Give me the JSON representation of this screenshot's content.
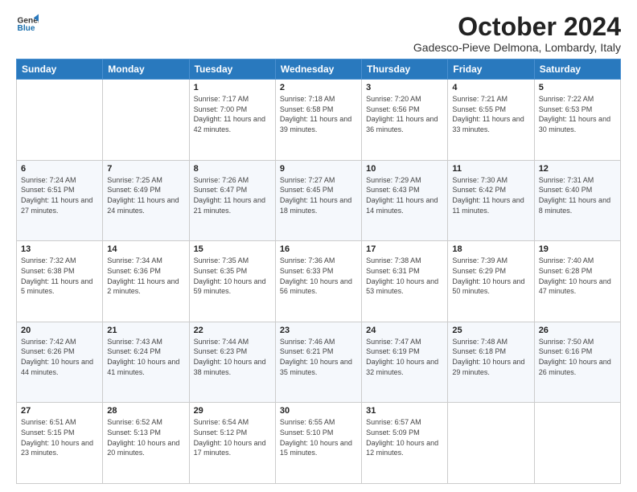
{
  "header": {
    "logo_line1": "General",
    "logo_line2": "Blue",
    "month": "October 2024",
    "location": "Gadesco-Pieve Delmona, Lombardy, Italy"
  },
  "days_of_week": [
    "Sunday",
    "Monday",
    "Tuesday",
    "Wednesday",
    "Thursday",
    "Friday",
    "Saturday"
  ],
  "weeks": [
    [
      {
        "day": "",
        "info": ""
      },
      {
        "day": "",
        "info": ""
      },
      {
        "day": "1",
        "info": "Sunrise: 7:17 AM\nSunset: 7:00 PM\nDaylight: 11 hours and 42 minutes."
      },
      {
        "day": "2",
        "info": "Sunrise: 7:18 AM\nSunset: 6:58 PM\nDaylight: 11 hours and 39 minutes."
      },
      {
        "day": "3",
        "info": "Sunrise: 7:20 AM\nSunset: 6:56 PM\nDaylight: 11 hours and 36 minutes."
      },
      {
        "day": "4",
        "info": "Sunrise: 7:21 AM\nSunset: 6:55 PM\nDaylight: 11 hours and 33 minutes."
      },
      {
        "day": "5",
        "info": "Sunrise: 7:22 AM\nSunset: 6:53 PM\nDaylight: 11 hours and 30 minutes."
      }
    ],
    [
      {
        "day": "6",
        "info": "Sunrise: 7:24 AM\nSunset: 6:51 PM\nDaylight: 11 hours and 27 minutes."
      },
      {
        "day": "7",
        "info": "Sunrise: 7:25 AM\nSunset: 6:49 PM\nDaylight: 11 hours and 24 minutes."
      },
      {
        "day": "8",
        "info": "Sunrise: 7:26 AM\nSunset: 6:47 PM\nDaylight: 11 hours and 21 minutes."
      },
      {
        "day": "9",
        "info": "Sunrise: 7:27 AM\nSunset: 6:45 PM\nDaylight: 11 hours and 18 minutes."
      },
      {
        "day": "10",
        "info": "Sunrise: 7:29 AM\nSunset: 6:43 PM\nDaylight: 11 hours and 14 minutes."
      },
      {
        "day": "11",
        "info": "Sunrise: 7:30 AM\nSunset: 6:42 PM\nDaylight: 11 hours and 11 minutes."
      },
      {
        "day": "12",
        "info": "Sunrise: 7:31 AM\nSunset: 6:40 PM\nDaylight: 11 hours and 8 minutes."
      }
    ],
    [
      {
        "day": "13",
        "info": "Sunrise: 7:32 AM\nSunset: 6:38 PM\nDaylight: 11 hours and 5 minutes."
      },
      {
        "day": "14",
        "info": "Sunrise: 7:34 AM\nSunset: 6:36 PM\nDaylight: 11 hours and 2 minutes."
      },
      {
        "day": "15",
        "info": "Sunrise: 7:35 AM\nSunset: 6:35 PM\nDaylight: 10 hours and 59 minutes."
      },
      {
        "day": "16",
        "info": "Sunrise: 7:36 AM\nSunset: 6:33 PM\nDaylight: 10 hours and 56 minutes."
      },
      {
        "day": "17",
        "info": "Sunrise: 7:38 AM\nSunset: 6:31 PM\nDaylight: 10 hours and 53 minutes."
      },
      {
        "day": "18",
        "info": "Sunrise: 7:39 AM\nSunset: 6:29 PM\nDaylight: 10 hours and 50 minutes."
      },
      {
        "day": "19",
        "info": "Sunrise: 7:40 AM\nSunset: 6:28 PM\nDaylight: 10 hours and 47 minutes."
      }
    ],
    [
      {
        "day": "20",
        "info": "Sunrise: 7:42 AM\nSunset: 6:26 PM\nDaylight: 10 hours and 44 minutes."
      },
      {
        "day": "21",
        "info": "Sunrise: 7:43 AM\nSunset: 6:24 PM\nDaylight: 10 hours and 41 minutes."
      },
      {
        "day": "22",
        "info": "Sunrise: 7:44 AM\nSunset: 6:23 PM\nDaylight: 10 hours and 38 minutes."
      },
      {
        "day": "23",
        "info": "Sunrise: 7:46 AM\nSunset: 6:21 PM\nDaylight: 10 hours and 35 minutes."
      },
      {
        "day": "24",
        "info": "Sunrise: 7:47 AM\nSunset: 6:19 PM\nDaylight: 10 hours and 32 minutes."
      },
      {
        "day": "25",
        "info": "Sunrise: 7:48 AM\nSunset: 6:18 PM\nDaylight: 10 hours and 29 minutes."
      },
      {
        "day": "26",
        "info": "Sunrise: 7:50 AM\nSunset: 6:16 PM\nDaylight: 10 hours and 26 minutes."
      }
    ],
    [
      {
        "day": "27",
        "info": "Sunrise: 6:51 AM\nSunset: 5:15 PM\nDaylight: 10 hours and 23 minutes."
      },
      {
        "day": "28",
        "info": "Sunrise: 6:52 AM\nSunset: 5:13 PM\nDaylight: 10 hours and 20 minutes."
      },
      {
        "day": "29",
        "info": "Sunrise: 6:54 AM\nSunset: 5:12 PM\nDaylight: 10 hours and 17 minutes."
      },
      {
        "day": "30",
        "info": "Sunrise: 6:55 AM\nSunset: 5:10 PM\nDaylight: 10 hours and 15 minutes."
      },
      {
        "day": "31",
        "info": "Sunrise: 6:57 AM\nSunset: 5:09 PM\nDaylight: 10 hours and 12 minutes."
      },
      {
        "day": "",
        "info": ""
      },
      {
        "day": "",
        "info": ""
      }
    ]
  ]
}
